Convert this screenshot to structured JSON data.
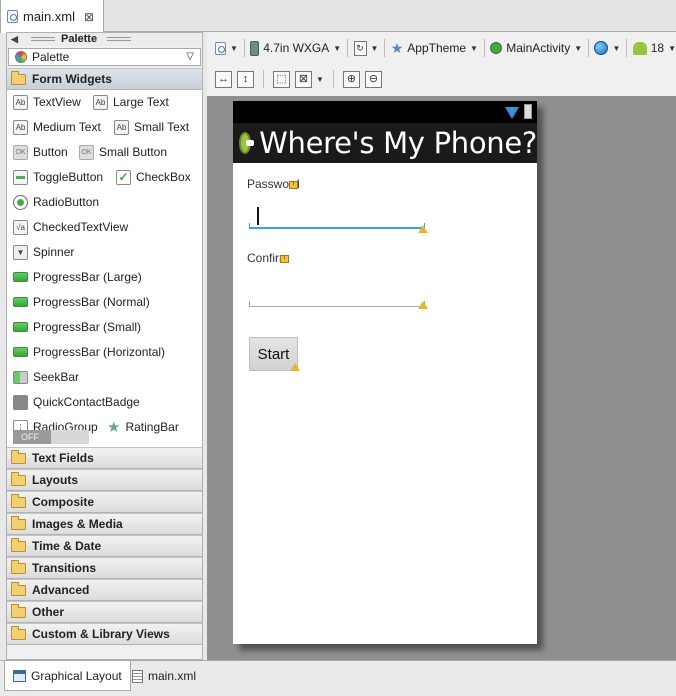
{
  "editor_tab": {
    "label": "main.xml",
    "close": "⊠"
  },
  "palette": {
    "title": "Palette",
    "selector": "Palette",
    "open_category": "Form Widgets",
    "widgets": {
      "textview": "TextView",
      "large_text": "Large Text",
      "medium_text": "Medium Text",
      "small_text": "Small Text",
      "button": "Button",
      "small_button": "Small Button",
      "toggle_button": "ToggleButton",
      "checkbox": "CheckBox",
      "radio_button": "RadioButton",
      "checked_text_view": "CheckedTextView",
      "spinner": "Spinner",
      "progress_large": "ProgressBar (Large)",
      "progress_normal": "ProgressBar (Normal)",
      "progress_small": "ProgressBar (Small)",
      "progress_horizontal": "ProgressBar (Horizontal)",
      "seekbar": "SeekBar",
      "quick_contact_badge": "QuickContactBadge",
      "radio_group": "RadioGroup",
      "rating_bar": "RatingBar",
      "switch": "OFF"
    },
    "icon_text": {
      "ab": "Ab",
      "ok": "OK"
    },
    "categories": [
      "Text Fields",
      "Layouts",
      "Composite",
      "Images & Media",
      "Time & Date",
      "Transitions",
      "Advanced",
      "Other",
      "Custom & Library Views"
    ]
  },
  "toolbar": {
    "device": "4.7in WXGA",
    "theme": "AppTheme",
    "activity": "MainActivity",
    "api_level": "18"
  },
  "screen": {
    "app_title": "Where's My Phone?",
    "password_label": "Password",
    "confirm_label": "Confirm",
    "start_button": "Start"
  },
  "bottom_tabs": {
    "graphical_layout": "Graphical Layout",
    "xml": "main.xml"
  },
  "colors": {
    "focus_underline": "#33a6d8",
    "action_bar": "#1a1a1a",
    "warning": "#e7b628"
  }
}
